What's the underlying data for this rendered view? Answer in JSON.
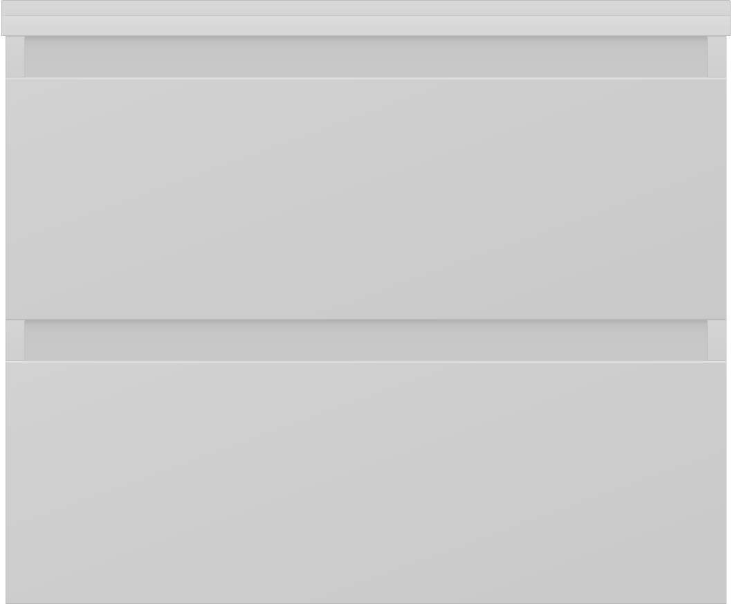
{
  "image": {
    "subject": "two-drawer-vanity-unit-front",
    "colors": {
      "finish": "#cdcdcd",
      "countertop": "#d6d6d6",
      "recess": "#c2c2c2",
      "background": "#ffffff"
    },
    "drawers": [
      {
        "name": "upper-drawer"
      },
      {
        "name": "lower-drawer"
      }
    ]
  }
}
